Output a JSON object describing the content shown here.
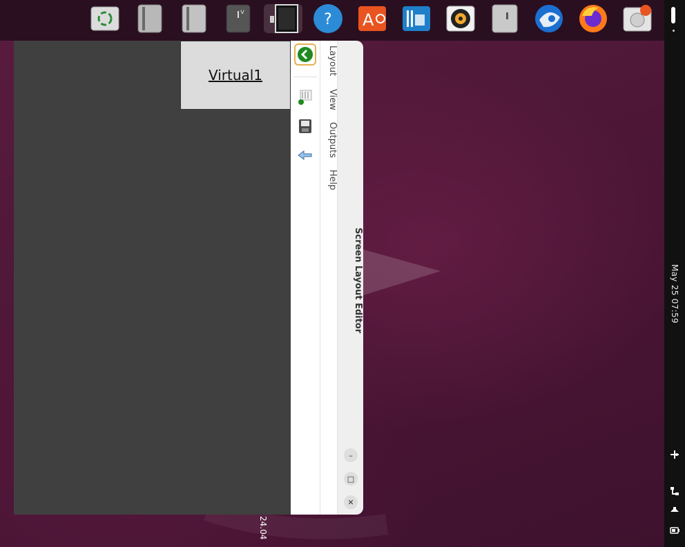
{
  "desktop": {
    "version_label": "24.04"
  },
  "dock": {
    "items": [
      {
        "name": "trash",
        "icon": "recycle-bin-icon"
      },
      {
        "name": "drive-1",
        "icon": "drive-icon"
      },
      {
        "name": "drive-2",
        "icon": "drive-icon"
      },
      {
        "name": "drive-3",
        "icon": "drive-icon"
      },
      {
        "name": "screen-layout-editor",
        "icon": "display-icon"
      },
      {
        "name": "help",
        "icon": "help-icon"
      },
      {
        "name": "app-center",
        "icon": "app-center-icon"
      },
      {
        "name": "libreoffice-impress",
        "icon": "impress-icon"
      },
      {
        "name": "rhythmbox",
        "icon": "speaker-icon"
      },
      {
        "name": "usb-drive",
        "icon": "usb-icon"
      },
      {
        "name": "thunderbird",
        "icon": "thunderbird-icon"
      },
      {
        "name": "firefox",
        "icon": "firefox-icon"
      },
      {
        "name": "ubuntu-installer",
        "icon": "installer-icon"
      }
    ]
  },
  "panel": {
    "clock": "May 25  07:59"
  },
  "window": {
    "title": "Screen Layout Editor",
    "menu": [
      "Layout",
      "View",
      "Outputs",
      "Help"
    ],
    "monitor_label": "Virtual1",
    "minimize_label": "–",
    "maximize_label": "□",
    "close_label": "✕"
  },
  "colors": {
    "accent_apply_border": "#e6b04f",
    "apply_green": "#1f8a1f",
    "canvas_bg": "#404040",
    "desktop_bg": "#4d1a36"
  }
}
